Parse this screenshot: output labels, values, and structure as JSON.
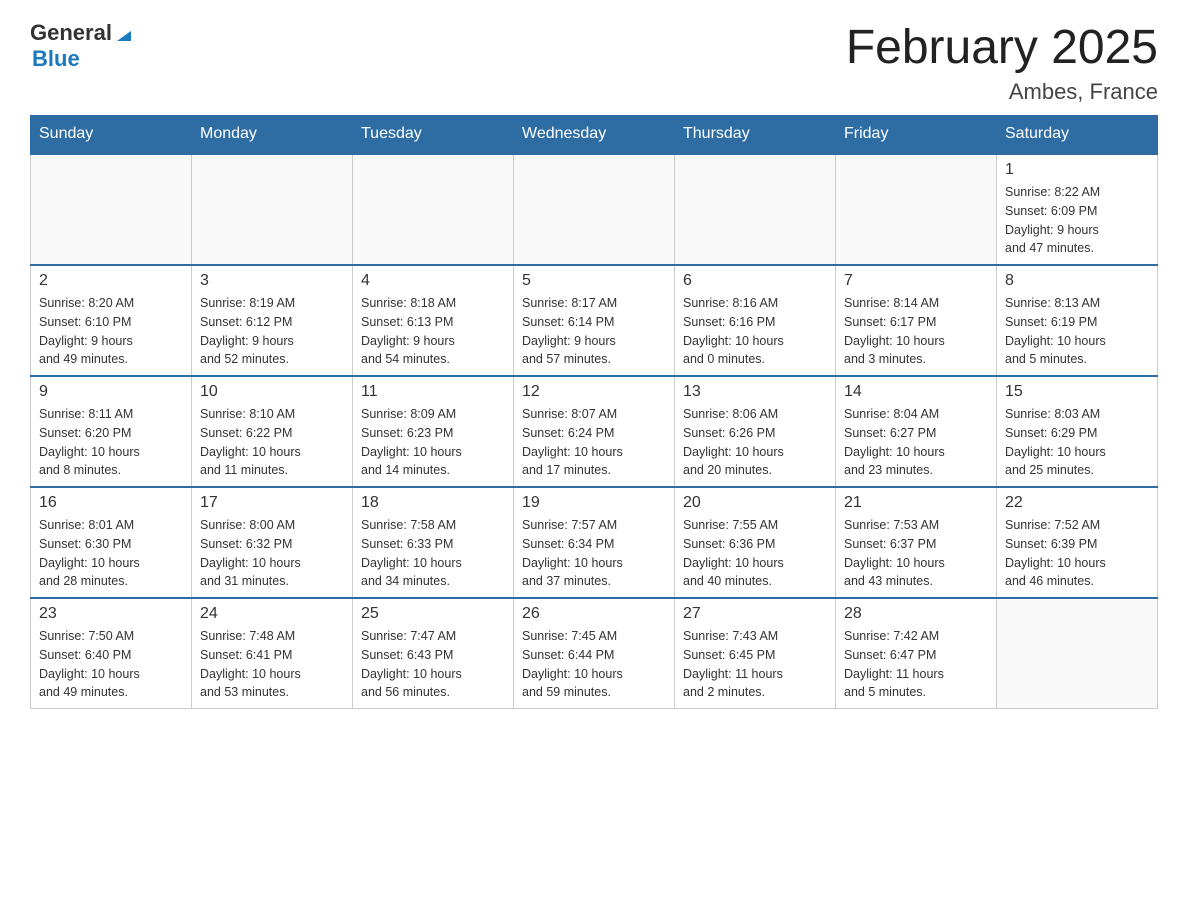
{
  "header": {
    "logo_general": "General",
    "logo_arrow": "▶",
    "logo_blue": "Blue",
    "title": "February 2025",
    "subtitle": "Ambes, France"
  },
  "days_of_week": [
    "Sunday",
    "Monday",
    "Tuesday",
    "Wednesday",
    "Thursday",
    "Friday",
    "Saturday"
  ],
  "weeks": [
    [
      {
        "day": "",
        "info": ""
      },
      {
        "day": "",
        "info": ""
      },
      {
        "day": "",
        "info": ""
      },
      {
        "day": "",
        "info": ""
      },
      {
        "day": "",
        "info": ""
      },
      {
        "day": "",
        "info": ""
      },
      {
        "day": "1",
        "info": "Sunrise: 8:22 AM\nSunset: 6:09 PM\nDaylight: 9 hours\nand 47 minutes."
      }
    ],
    [
      {
        "day": "2",
        "info": "Sunrise: 8:20 AM\nSunset: 6:10 PM\nDaylight: 9 hours\nand 49 minutes."
      },
      {
        "day": "3",
        "info": "Sunrise: 8:19 AM\nSunset: 6:12 PM\nDaylight: 9 hours\nand 52 minutes."
      },
      {
        "day": "4",
        "info": "Sunrise: 8:18 AM\nSunset: 6:13 PM\nDaylight: 9 hours\nand 54 minutes."
      },
      {
        "day": "5",
        "info": "Sunrise: 8:17 AM\nSunset: 6:14 PM\nDaylight: 9 hours\nand 57 minutes."
      },
      {
        "day": "6",
        "info": "Sunrise: 8:16 AM\nSunset: 6:16 PM\nDaylight: 10 hours\nand 0 minutes."
      },
      {
        "day": "7",
        "info": "Sunrise: 8:14 AM\nSunset: 6:17 PM\nDaylight: 10 hours\nand 3 minutes."
      },
      {
        "day": "8",
        "info": "Sunrise: 8:13 AM\nSunset: 6:19 PM\nDaylight: 10 hours\nand 5 minutes."
      }
    ],
    [
      {
        "day": "9",
        "info": "Sunrise: 8:11 AM\nSunset: 6:20 PM\nDaylight: 10 hours\nand 8 minutes."
      },
      {
        "day": "10",
        "info": "Sunrise: 8:10 AM\nSunset: 6:22 PM\nDaylight: 10 hours\nand 11 minutes."
      },
      {
        "day": "11",
        "info": "Sunrise: 8:09 AM\nSunset: 6:23 PM\nDaylight: 10 hours\nand 14 minutes."
      },
      {
        "day": "12",
        "info": "Sunrise: 8:07 AM\nSunset: 6:24 PM\nDaylight: 10 hours\nand 17 minutes."
      },
      {
        "day": "13",
        "info": "Sunrise: 8:06 AM\nSunset: 6:26 PM\nDaylight: 10 hours\nand 20 minutes."
      },
      {
        "day": "14",
        "info": "Sunrise: 8:04 AM\nSunset: 6:27 PM\nDaylight: 10 hours\nand 23 minutes."
      },
      {
        "day": "15",
        "info": "Sunrise: 8:03 AM\nSunset: 6:29 PM\nDaylight: 10 hours\nand 25 minutes."
      }
    ],
    [
      {
        "day": "16",
        "info": "Sunrise: 8:01 AM\nSunset: 6:30 PM\nDaylight: 10 hours\nand 28 minutes."
      },
      {
        "day": "17",
        "info": "Sunrise: 8:00 AM\nSunset: 6:32 PM\nDaylight: 10 hours\nand 31 minutes."
      },
      {
        "day": "18",
        "info": "Sunrise: 7:58 AM\nSunset: 6:33 PM\nDaylight: 10 hours\nand 34 minutes."
      },
      {
        "day": "19",
        "info": "Sunrise: 7:57 AM\nSunset: 6:34 PM\nDaylight: 10 hours\nand 37 minutes."
      },
      {
        "day": "20",
        "info": "Sunrise: 7:55 AM\nSunset: 6:36 PM\nDaylight: 10 hours\nand 40 minutes."
      },
      {
        "day": "21",
        "info": "Sunrise: 7:53 AM\nSunset: 6:37 PM\nDaylight: 10 hours\nand 43 minutes."
      },
      {
        "day": "22",
        "info": "Sunrise: 7:52 AM\nSunset: 6:39 PM\nDaylight: 10 hours\nand 46 minutes."
      }
    ],
    [
      {
        "day": "23",
        "info": "Sunrise: 7:50 AM\nSunset: 6:40 PM\nDaylight: 10 hours\nand 49 minutes."
      },
      {
        "day": "24",
        "info": "Sunrise: 7:48 AM\nSunset: 6:41 PM\nDaylight: 10 hours\nand 53 minutes."
      },
      {
        "day": "25",
        "info": "Sunrise: 7:47 AM\nSunset: 6:43 PM\nDaylight: 10 hours\nand 56 minutes."
      },
      {
        "day": "26",
        "info": "Sunrise: 7:45 AM\nSunset: 6:44 PM\nDaylight: 10 hours\nand 59 minutes."
      },
      {
        "day": "27",
        "info": "Sunrise: 7:43 AM\nSunset: 6:45 PM\nDaylight: 11 hours\nand 2 minutes."
      },
      {
        "day": "28",
        "info": "Sunrise: 7:42 AM\nSunset: 6:47 PM\nDaylight: 11 hours\nand 5 minutes."
      },
      {
        "day": "",
        "info": ""
      }
    ]
  ]
}
